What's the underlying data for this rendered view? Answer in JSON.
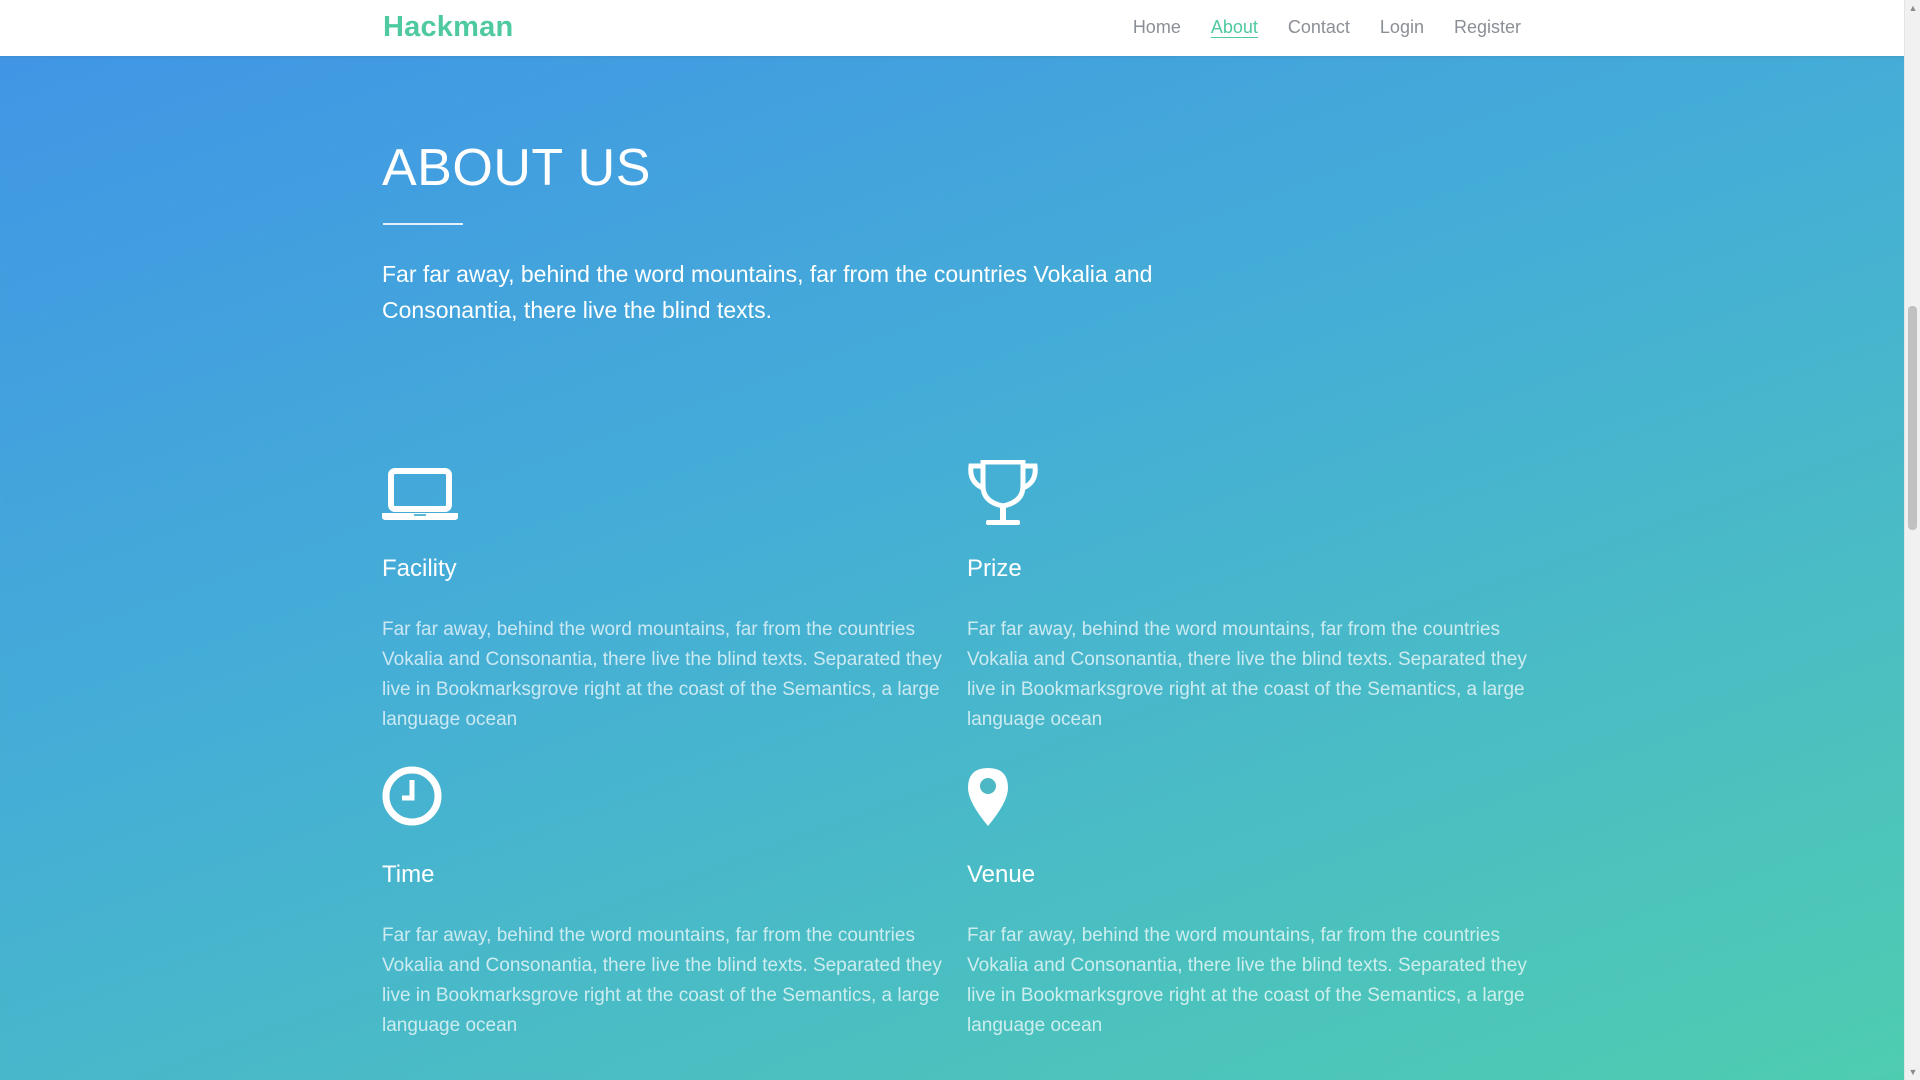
{
  "nav": {
    "brand": "Hackman",
    "links": [
      "Home",
      "About",
      "Contact",
      "Login",
      "Register"
    ],
    "active": "About"
  },
  "about": {
    "title": "ABOUT US",
    "lead": "Far far away, behind the word mountains, far from the countries Vokalia and Consonantia, there live the blind texts."
  },
  "features": [
    {
      "icon": "laptop-icon",
      "title": "Facility",
      "text": "Far far away, behind the word mountains, far from the countries Vokalia and Consonantia, there live the blind texts. Separated they live in Bookmarksgrove right at the coast of the Semantics, a large language ocean"
    },
    {
      "icon": "trophy-icon",
      "title": "Prize",
      "text": "Far far away, behind the word mountains, far from the countries Vokalia and Consonantia, there live the blind texts. Separated they live in Bookmarksgrove right at the coast of the Semantics, a large language ocean"
    },
    {
      "icon": "clock-icon",
      "title": "Time",
      "text": "Far far away, behind the word mountains, far from the countries Vokalia and Consonantia, there live the blind texts. Separated they live in Bookmarksgrove right at the coast of the Semantics, a large language ocean"
    },
    {
      "icon": "map-pin-icon",
      "title": "Venue",
      "text": "Far far away, behind the word mountains, far from the countries Vokalia and Consonantia, there live the blind texts. Separated they live in Bookmarksgrove right at the coast of the Semantics, a large language ocean"
    }
  ],
  "colors": {
    "brand": "#4ec9a0",
    "nav_text": "#8a8f96",
    "gradient_start": "#4094e6",
    "gradient_end": "#4fcdb0"
  }
}
